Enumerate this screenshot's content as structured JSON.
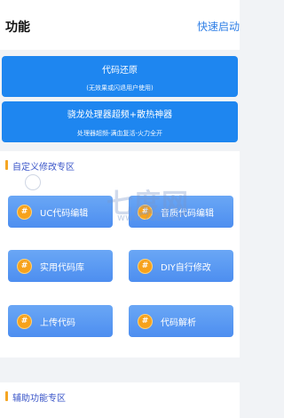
{
  "header": {
    "title": "功能",
    "quick_start": "快速启动"
  },
  "buttons": [
    {
      "main": "代码还原",
      "sub": "(无效果或闪退用户使用)"
    },
    {
      "main": "骁龙处理器超频+散热神器",
      "sub": "处理器超频-满血复活-火力全开"
    }
  ],
  "custom_section": {
    "title": "自定义修改专区",
    "tiles": [
      {
        "label": "UC代码编辑",
        "icon": "coin-icon",
        "glyph": "#"
      },
      {
        "label": "音质代码编辑",
        "icon": "coin-icon",
        "glyph": "#"
      },
      {
        "label": "实用代码库",
        "icon": "coin-icon",
        "glyph": "#"
      },
      {
        "label": "DIY自行修改",
        "icon": "coin-icon",
        "glyph": "#"
      },
      {
        "label": "上传代码",
        "icon": "coin-icon",
        "glyph": "#"
      },
      {
        "label": "代码解析",
        "icon": "coin-icon",
        "glyph": "#"
      }
    ]
  },
  "aux_section": {
    "title": "辅助功能专区"
  },
  "watermark": {
    "text": "七度网",
    "url": "www.7do.net"
  },
  "colors": {
    "accent": "#1e86f0",
    "tile": "#5a99f2",
    "coin": "#f7a21c",
    "section_title": "#3a55c8",
    "quick_start": "#2f7fe6"
  }
}
